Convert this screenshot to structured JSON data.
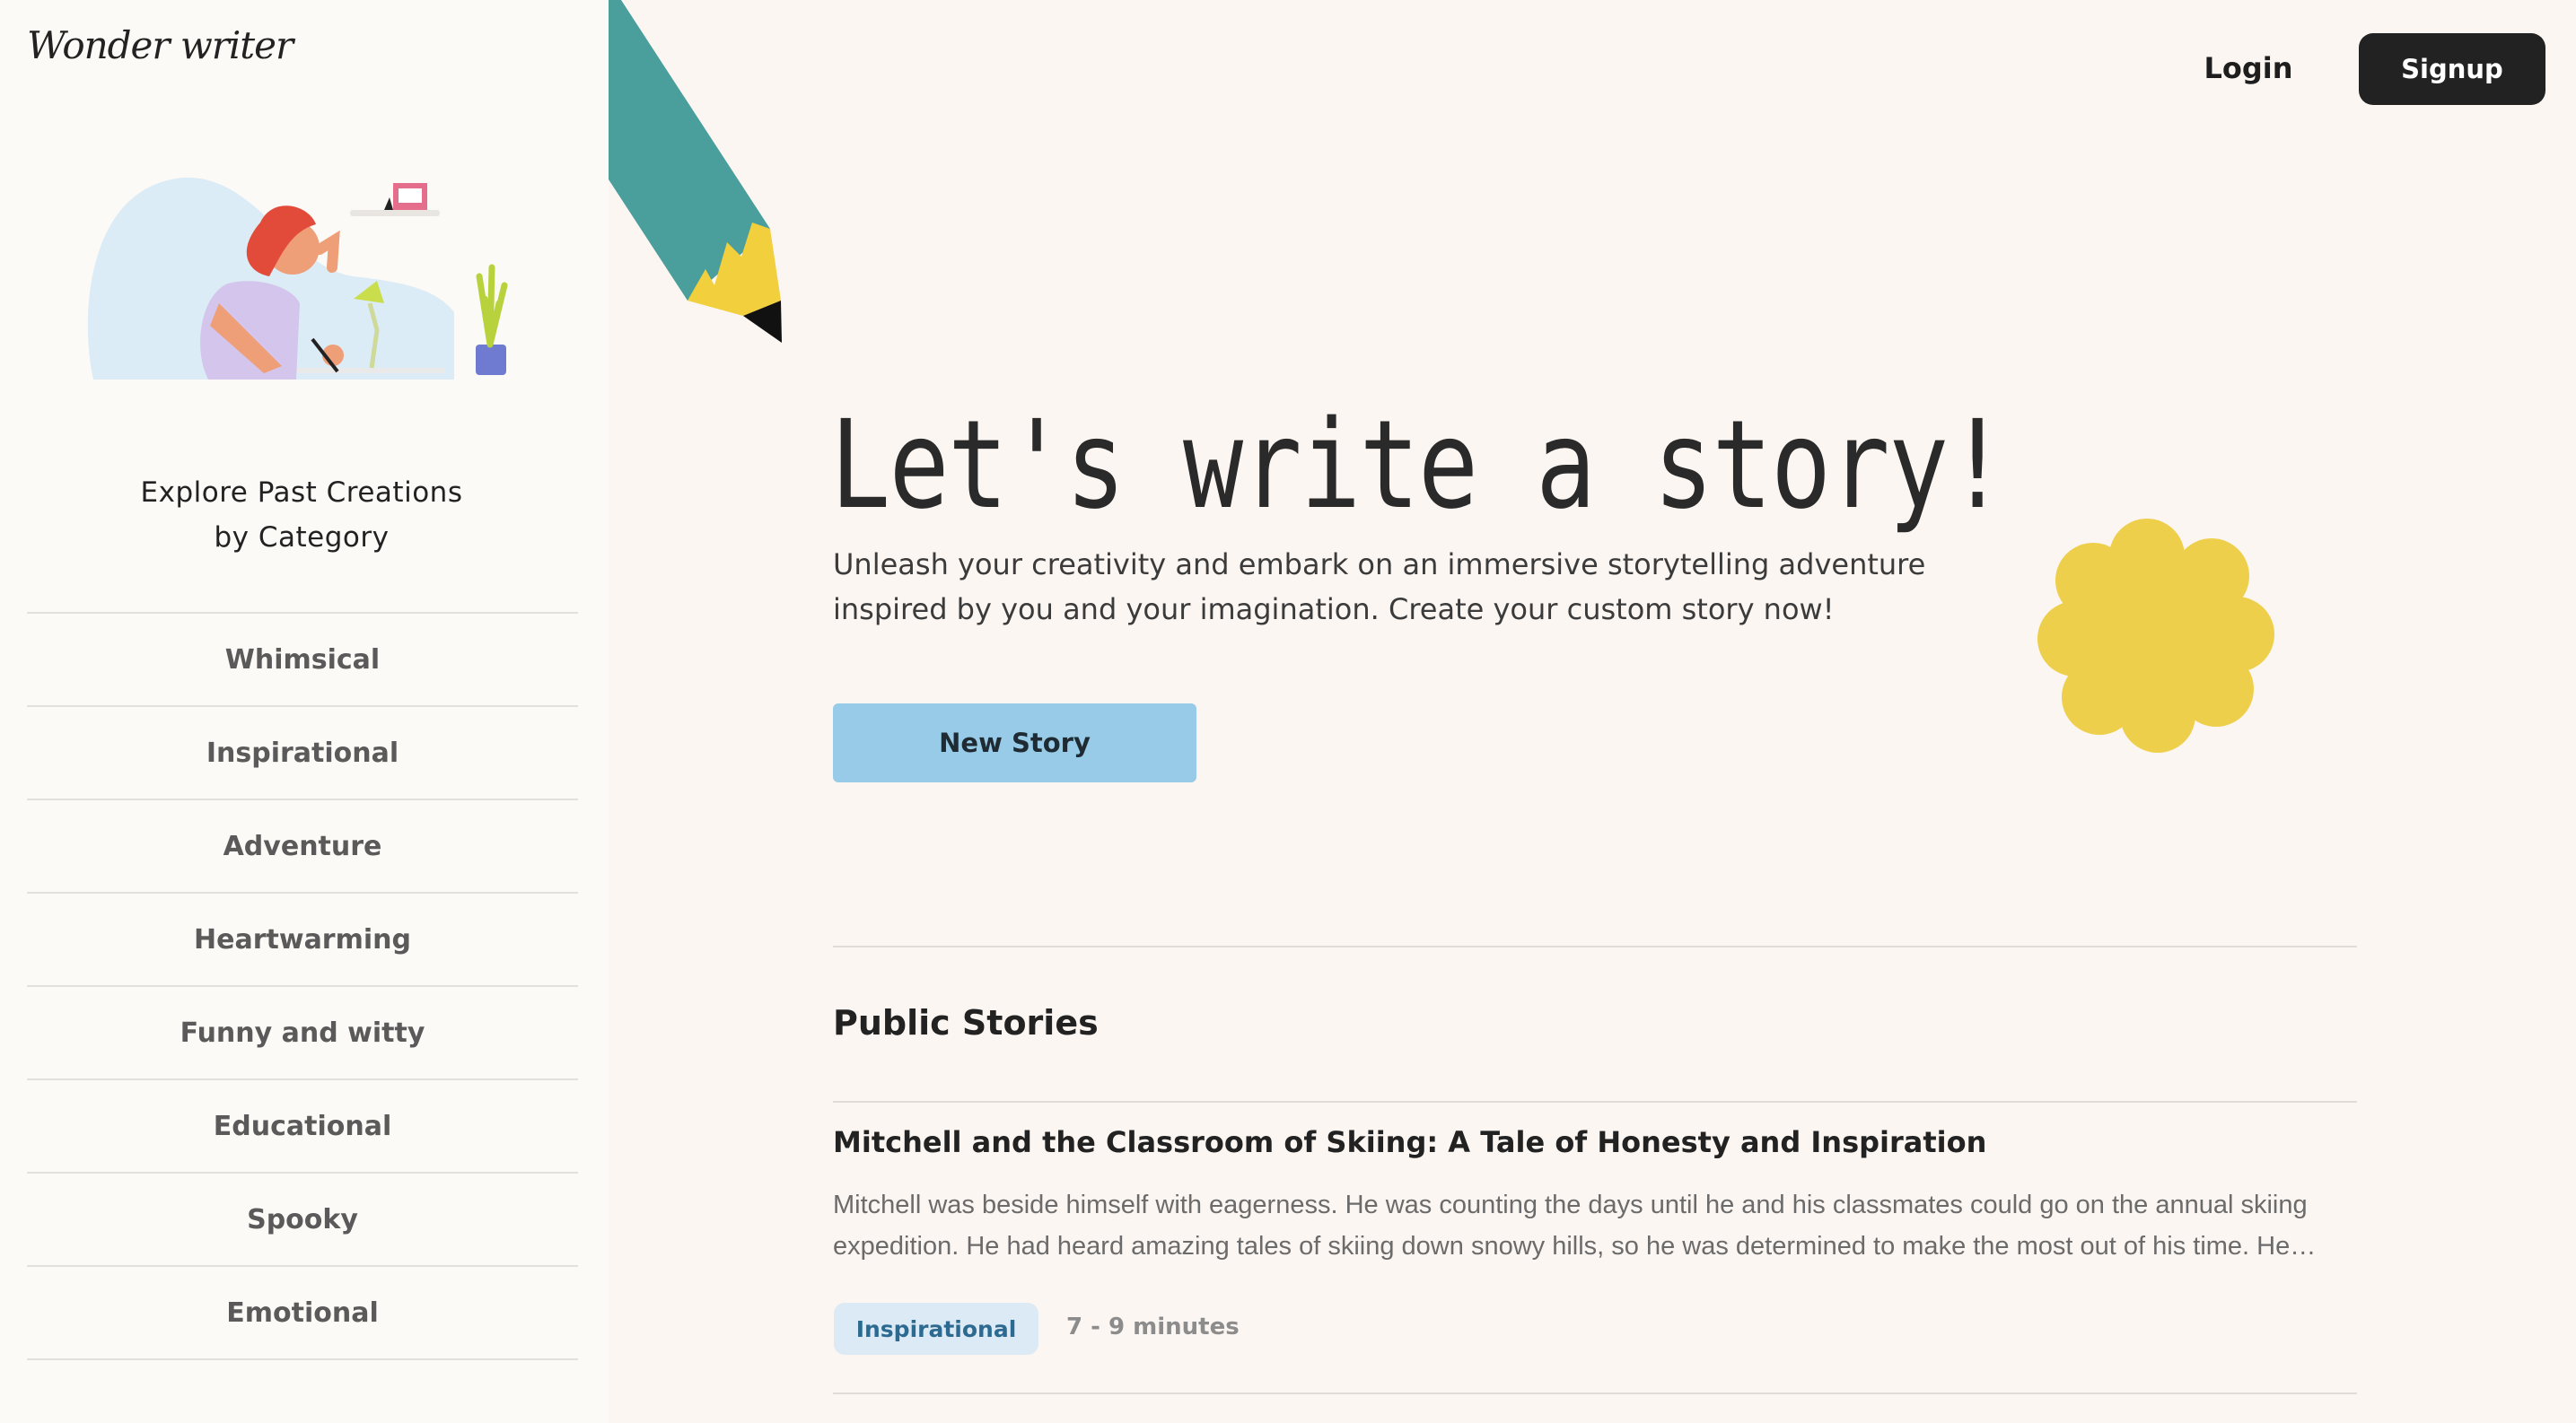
{
  "brand": {
    "logo_text": "Wonder writer"
  },
  "sidebar": {
    "heading_line1": "Explore Past Creations",
    "heading_line2": "by Category",
    "categories": [
      "Whimsical",
      "Inspirational",
      "Adventure",
      "Heartwarming",
      "Funny and witty",
      "Educational",
      "Spooky",
      "Emotional"
    ]
  },
  "header": {
    "login_label": "Login",
    "signup_label": "Signup"
  },
  "hero": {
    "title": "Let's write a story!",
    "subtitle_line1": "Unleash your creativity and embark on an immersive storytelling adventure",
    "subtitle_line2": "inspired by you and your imagination. Create your custom story now!",
    "cta_label": "New Story"
  },
  "public_stories": {
    "heading": "Public Stories",
    "items": [
      {
        "title": "Mitchell and the Classroom of Skiing: A Tale of Honesty and Inspiration",
        "excerpt_line1": "Mitchell was beside himself with eagerness. He was counting the days until he and his classmates could go on the annual skiing",
        "excerpt_line2": "expedition. He had heard amazing tales of skiing down snowy hills, so he was determined to make the most out of his time. He…",
        "tag": "Inspirational",
        "duration": "7 - 9 minutes"
      }
    ]
  },
  "colors": {
    "page_bg": "#fcf6f2",
    "sidebar_bg": "#fcfaf7",
    "cta": "#97cbe8",
    "signup_bg": "#222222",
    "pencil_body": "#4a9e9c",
    "pencil_tip": "#f2cf3c",
    "flower": "#eecf4b"
  },
  "icons": {
    "pencil": "pencil-illustration-icon",
    "flower": "flower-decoration-icon"
  }
}
